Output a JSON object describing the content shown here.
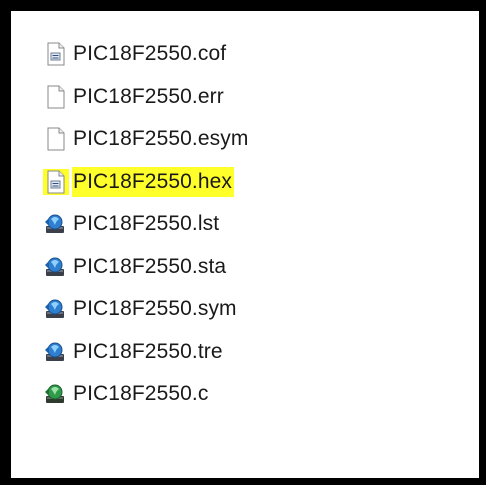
{
  "files": [
    {
      "name": "PIC18F2550.cof",
      "icon": "calc-doc-icon",
      "highlight": false
    },
    {
      "name": "PIC18F2550.err",
      "icon": "blank-doc-icon",
      "highlight": false
    },
    {
      "name": "PIC18F2550.esym",
      "icon": "blank-doc-icon",
      "highlight": false
    },
    {
      "name": "PIC18F2550.hex",
      "icon": "calc-doc-icon",
      "highlight": true
    },
    {
      "name": "PIC18F2550.lst",
      "icon": "ccs-app-icon",
      "highlight": false
    },
    {
      "name": "PIC18F2550.sta",
      "icon": "ccs-app-icon",
      "highlight": false
    },
    {
      "name": "PIC18F2550.sym",
      "icon": "ccs-app-icon",
      "highlight": false
    },
    {
      "name": "PIC18F2550.tre",
      "icon": "ccs-app-icon",
      "highlight": false
    },
    {
      "name": "PIC18F2550.c",
      "icon": "ccs-source-icon",
      "highlight": false
    }
  ],
  "colors": {
    "highlight": "#ffff2a",
    "frame": "#000000"
  }
}
